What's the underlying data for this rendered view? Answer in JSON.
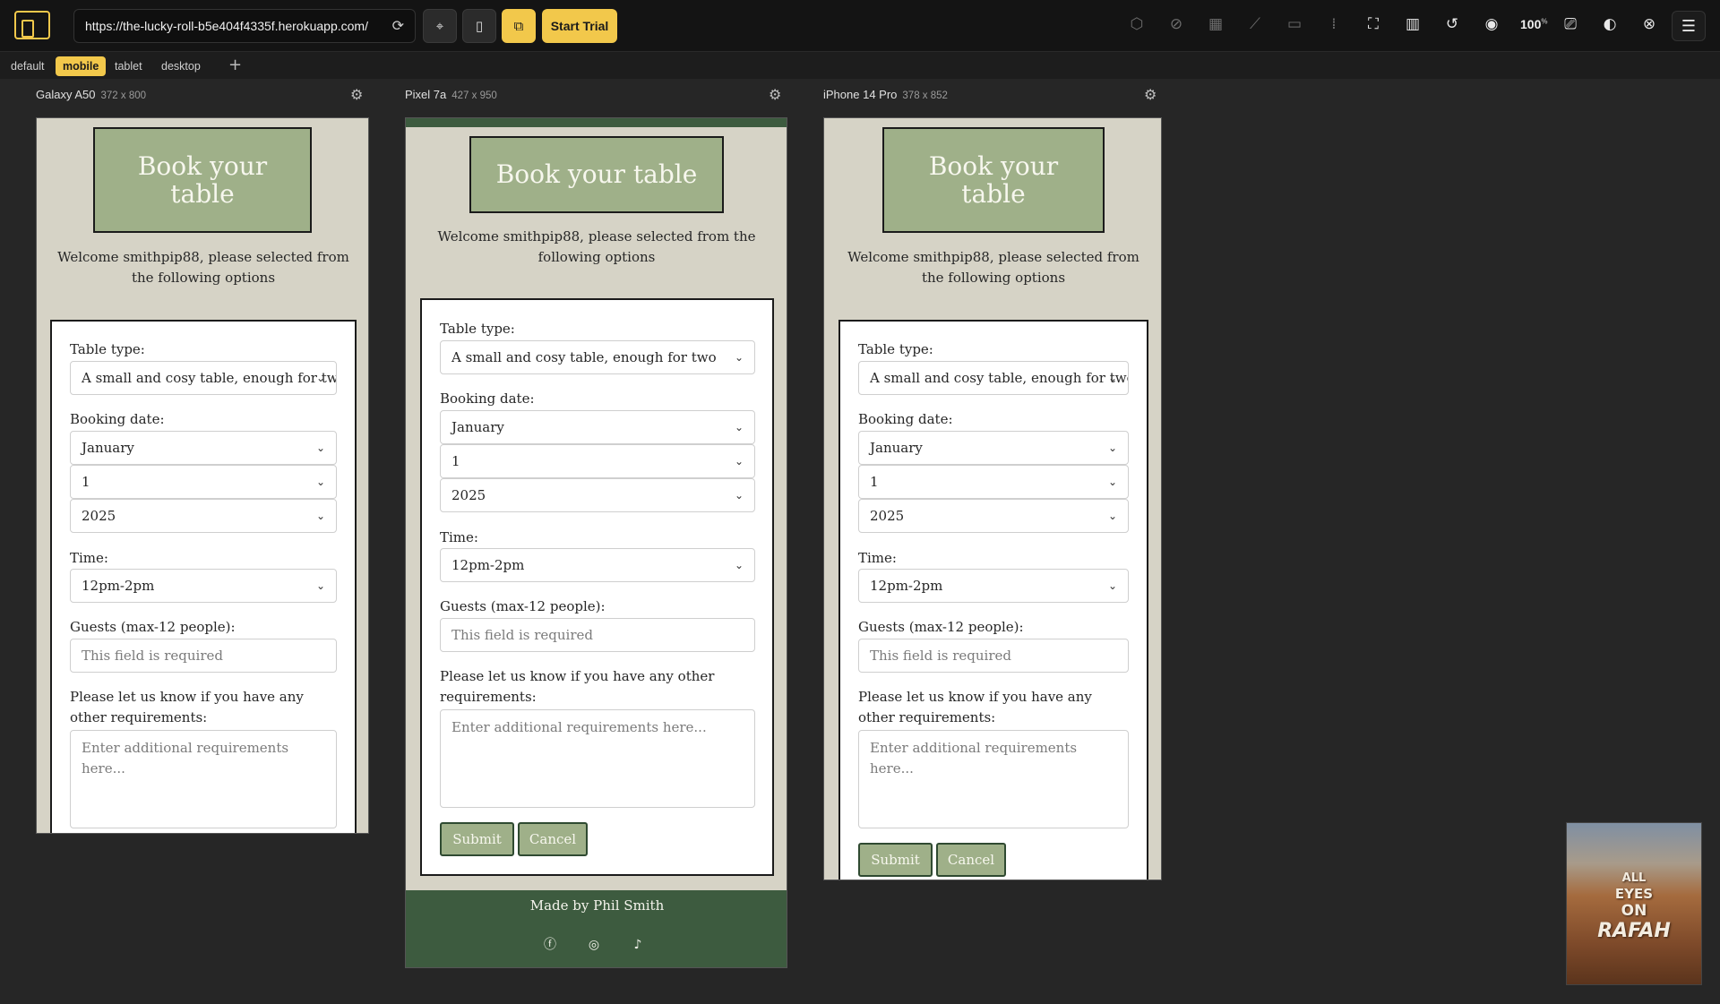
{
  "toolbar": {
    "url": "https://the-lucky-roll-b5e404f4335f.herokuapp.com/",
    "start_trial_label": "Start Trial",
    "zoom_level": "100",
    "zoom_unit": "%"
  },
  "tabs": [
    "default",
    "mobile",
    "tablet",
    "desktop"
  ],
  "add_tab_label": "+",
  "devices": [
    {
      "name": "Galaxy A50",
      "dims": "372 x 800"
    },
    {
      "name": "Pixel 7a",
      "dims": "427 x 950"
    },
    {
      "name": "iPhone 14 Pro",
      "dims": "378 x 852"
    }
  ],
  "form": {
    "title": "Book your table",
    "welcome": "Welcome smithpip88, please selected from the following options",
    "table_type_label": "Table type:",
    "table_type_value": "A small and cosy table, enough for two",
    "booking_date_label": "Booking date:",
    "month_value": "January",
    "day_value": "1",
    "year_value": "2025",
    "time_label": "Time:",
    "time_value": "12pm-2pm",
    "guests_label": "Guests (max-12 people):",
    "guests_placeholder": "This field is required",
    "requirements_label": "Please let us know if you have any other requirements:",
    "requirements_placeholder": "Enter additional requirements here...",
    "submit_label": "Submit",
    "cancel_label": "Cancel"
  },
  "footer": {
    "made_by": "Made by Phil Smith",
    "social_icons": [
      "facebook-icon",
      "instagram-icon",
      "tiktok-icon"
    ]
  },
  "thumbnail": {
    "lines": [
      "ALL",
      "EYES",
      "ON",
      "RAFAH"
    ]
  },
  "colors": {
    "accent": "#f2c84b",
    "page_bg": "#d6d3c6",
    "sage": "#9fb089",
    "dark_green": "#3d5b3f"
  }
}
